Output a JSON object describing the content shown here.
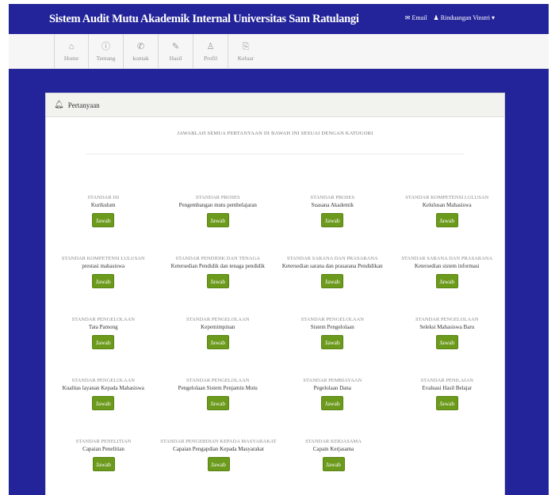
{
  "header": {
    "title": "Sistem Audit Mutu Akademik Internal Universitas Sam Ratulangi",
    "user_links": [
      "Email",
      "Rinduangan Vinstri"
    ]
  },
  "nav": [
    {
      "label": "Home",
      "icon": "home-icon",
      "glyph": "⌂"
    },
    {
      "label": "Tentang",
      "icon": "info-icon",
      "glyph": "ⓘ"
    },
    {
      "label": "kontak",
      "icon": "phone-icon",
      "glyph": "✆"
    },
    {
      "label": "Hasil",
      "icon": "pen-icon",
      "glyph": "✎"
    },
    {
      "label": "Profil",
      "icon": "user-icon",
      "glyph": "♙"
    },
    {
      "label": "Keluar",
      "icon": "logout-icon",
      "glyph": "⎘"
    }
  ],
  "panel": {
    "title": "Pertanyaan",
    "intro": "JAWABLAH SEMUA PERTANYAAN DI BAWAH INI SESUAI DENGAN KATOGORI"
  },
  "button_label": "Jawab",
  "questions": [
    [
      {
        "category": "STANDAR ISI",
        "topic": "Kurikulum"
      },
      {
        "category": "STANDAR PROSES",
        "topic": "Pengembangan mutu pembelajaran"
      },
      {
        "category": "STANDAR PROSES",
        "topic": "Suasana Akademik"
      },
      {
        "category": "STANDAR KOMPETENSI LULUSAN",
        "topic": "Kelulusan Mahasiswa"
      }
    ],
    [
      {
        "category": "STANDAR KOMPETENSI LULUSAN",
        "topic": "prestasi mahasiswa"
      },
      {
        "category": "STANDAR PENDIDIK DAN TENAGA",
        "topic": "Ketersedian Pendidik dan tenaga pendidik"
      },
      {
        "category": "STANDAR SARANA DAN PRASARANA",
        "topic": "Ketersedian sarana dan prasarana Pendidikan"
      },
      {
        "category": "STANDAR SARANA DAN PRASARANA",
        "topic": "Ketersedian sistem informasi"
      }
    ],
    [
      {
        "category": "STANDAR PENGELOLAAN",
        "topic": "Tata Pamong"
      },
      {
        "category": "STANDAR PENGELOLAAN",
        "topic": "Kepemimpinan"
      },
      {
        "category": "STANDAR PENGELOLAAN",
        "topic": "Sistem Pengelolaan"
      },
      {
        "category": "STANDAR PENGELOLAAN",
        "topic": "Seleksi Mahasiswa Baru"
      }
    ],
    [
      {
        "category": "STANDAR PENGELOLAAN",
        "topic": "Kualitas layanan Kepada Mahasiswa"
      },
      {
        "category": "STANDAR PENGELOLAAN",
        "topic": "Pengelolaan Sistem Penjamin Mutu"
      },
      {
        "category": "STANDAR PEMBIAYAAN",
        "topic": "Pegelolaan Dana"
      },
      {
        "category": "STANDAR PENILAIAN",
        "topic": "Evaluasi Hasil Belajar"
      }
    ],
    [
      {
        "category": "STANDAR PENELITIAN",
        "topic": "Capaian Penelitian"
      },
      {
        "category": "STANDAR PENGEBDIAN KEPADA MASYARAKAT",
        "topic": "Capaian Pengapdian Kepada Masyarakat"
      },
      {
        "category": "STANDAR KERJASAMA",
        "topic": "Capain Kerjasama"
      }
    ]
  ],
  "colors": {
    "frame": "#24249a",
    "button": "#6c9a1c"
  }
}
